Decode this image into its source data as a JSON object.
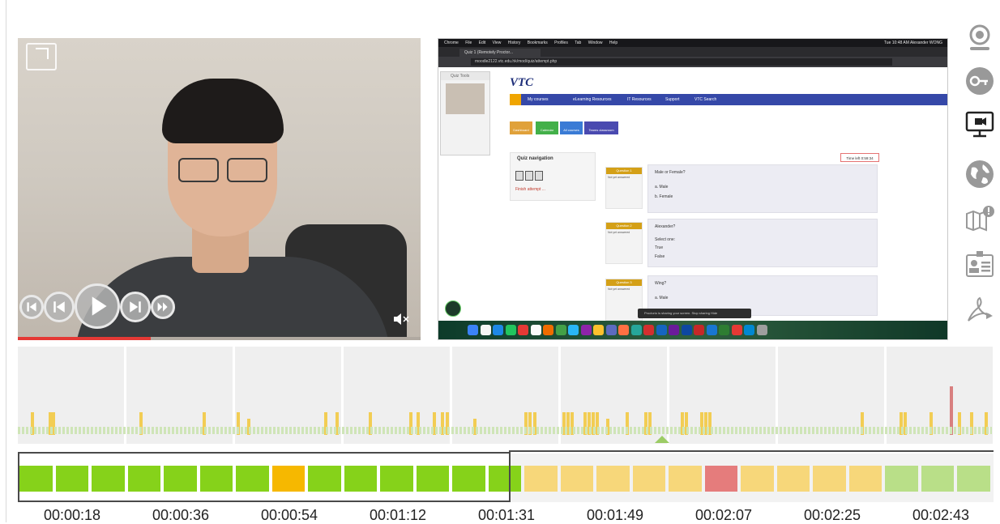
{
  "webcam": {
    "controls": [
      "step-back-icon",
      "skip-back-icon",
      "play-icon",
      "skip-forward-icon",
      "fast-forward-icon"
    ],
    "muted": true,
    "progress_fraction": 0.33
  },
  "screen": {
    "mac_menu": [
      "Chrome",
      "File",
      "Edit",
      "View",
      "History",
      "Bookmarks",
      "Profiles",
      "Tab",
      "Window",
      "Help"
    ],
    "mac_menu_right": "Tue 10:48 AM   Alexander WONG",
    "tab_title": "Quiz 1 (Remotely Proctor...",
    "url": "moodle2122.vtc.edu.hk/mod/quiz/attempt.php",
    "logo": "VTC",
    "nav": [
      "My courses",
      "eLearning Resources",
      "IT Resources",
      "Support",
      "VTC Search"
    ],
    "quiz_tools_label": "Quiz Tools",
    "quick_buttons": [
      "Dashboard",
      "Calendar",
      "All courses",
      "Teams classroom"
    ],
    "quiz_nav_title": "Quiz navigation",
    "finish_attempt": "Finish attempt ...",
    "timer": "Time left 0:59:34",
    "questions": [
      {
        "label": "Question 1",
        "status": "Not yet answered",
        "text": "Male or Female?",
        "options": [
          "a.  Male",
          "b.  Female"
        ]
      },
      {
        "label": "Question 2",
        "status": "Not yet answered",
        "text": "Alexander?",
        "options": [
          "Select one:",
          "True",
          "False"
        ]
      },
      {
        "label": "Question 3",
        "status": "Not yet answered",
        "text": "Wing?",
        "options": [
          "a.  Male"
        ]
      }
    ],
    "sharing_text": "Proctorio is sharing your screen.   Stop sharing   Hide"
  },
  "rail_icons": [
    "webcam-icon",
    "key-icon",
    "screen-icon",
    "globe-icon",
    "book-alert-icon",
    "id-card-icon",
    "pdf-icon"
  ],
  "timeline": {
    "times": [
      "00:00:18",
      "00:00:36",
      "00:00:54",
      "00:01:12",
      "00:01:31",
      "00:01:49",
      "00:02:07",
      "00:02:25",
      "00:02:43"
    ],
    "segments": [
      "green",
      "green",
      "green",
      "green",
      "green",
      "green",
      "green",
      "orange",
      "green",
      "green",
      "green",
      "green",
      "green",
      "green",
      "yellow",
      "yellow",
      "yellow",
      "yellow",
      "yellow",
      "red",
      "yellow",
      "yellow",
      "yellow",
      "yellow",
      "lightgreen",
      "lightgreen",
      "lightgreen"
    ],
    "colors": {
      "green": "#86d21a",
      "orange": "#f6b800",
      "yellow": "#f7d77a",
      "red": "#e57c7c",
      "lightgreen": "#b9df88"
    }
  }
}
